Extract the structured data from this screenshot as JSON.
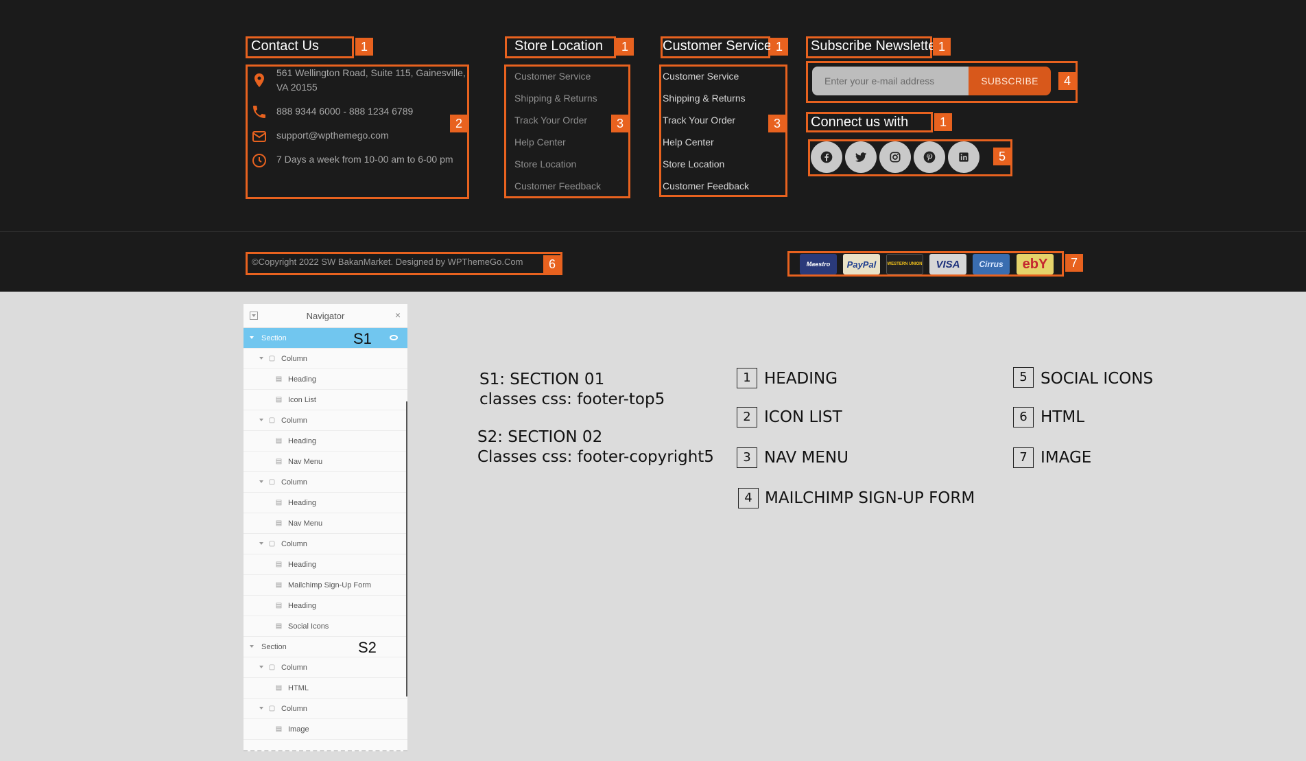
{
  "footer": {
    "contact": {
      "heading": "Contact Us",
      "address": "561 Wellington Road, Suite 115, Gainesville, VA 20155",
      "phone": "888 9344 6000 - 888 1234 6789",
      "email": "support@wpthemego.com",
      "hours": "7 Days a week from 10-00 am to 6-00 pm"
    },
    "store_location": {
      "heading": "Store Location",
      "items": [
        "Customer Service",
        "Shipping & Returns",
        "Track Your Order",
        "Help Center",
        "Store Location",
        "Customer Feedback"
      ]
    },
    "customer_service": {
      "heading": "Customer Service",
      "items": [
        "Customer Service",
        "Shipping & Returns",
        "Track Your Order",
        "Help Center",
        "Store Location",
        "Customer Feedback"
      ]
    },
    "newsletter": {
      "heading": "Subscribe Newsletter",
      "email_placeholder": "Enter your e-mail address",
      "subscribe_label": "SUBSCRIBE"
    },
    "connect": {
      "heading": "Connect us with",
      "icons": [
        "facebook-icon",
        "twitter-icon",
        "instagram-icon",
        "pinterest-icon",
        "linkedin-icon"
      ]
    },
    "copyright": "©Copyright 2022 SW BakanMarket. Designed by WPThemeGo.Com",
    "payments": [
      "Maestro",
      "PayPal",
      "WESTERN UNION",
      "VISA",
      "Cirrus",
      "ebY"
    ]
  },
  "badges": {
    "heading": "1",
    "icon_list": "2",
    "nav_menu": "3",
    "mailchimp": "4",
    "social": "5",
    "html": "6",
    "image": "7"
  },
  "navigator": {
    "title": "Navigator",
    "close": "×",
    "rows": [
      {
        "label": "Section",
        "type": "section",
        "tag": "S1"
      },
      {
        "label": "Column",
        "type": "column"
      },
      {
        "label": "Heading",
        "type": "widget"
      },
      {
        "label": "Icon List",
        "type": "widget"
      },
      {
        "label": "Column",
        "type": "column"
      },
      {
        "label": "Heading",
        "type": "widget"
      },
      {
        "label": "Nav Menu",
        "type": "widget"
      },
      {
        "label": "Column",
        "type": "column"
      },
      {
        "label": "Heading",
        "type": "widget"
      },
      {
        "label": "Nav Menu",
        "type": "widget"
      },
      {
        "label": "Column",
        "type": "column"
      },
      {
        "label": "Heading",
        "type": "widget"
      },
      {
        "label": "Mailchimp Sign-Up Form",
        "type": "widget"
      },
      {
        "label": "Heading",
        "type": "widget"
      },
      {
        "label": "Social Icons",
        "type": "widget"
      },
      {
        "label": "Section",
        "type": "section",
        "tag": "S2"
      },
      {
        "label": "Column",
        "type": "column"
      },
      {
        "label": "HTML",
        "type": "widget"
      },
      {
        "label": "Column",
        "type": "column"
      },
      {
        "label": "Image",
        "type": "widget"
      }
    ]
  },
  "legend": {
    "s1_title": "S1: SECTION 01",
    "s1_class": "classes css: footer-top5",
    "s2_title": "S2: SECTION 02",
    "s2_class": "Classes css: footer-copyright5",
    "items": [
      {
        "num": "1",
        "label": "HEADING"
      },
      {
        "num": "2",
        "label": "ICON LIST"
      },
      {
        "num": "3",
        "label": "NAV MENU"
      },
      {
        "num": "4",
        "label": "MAILCHIMP SIGN-UP FORM"
      },
      {
        "num": "5",
        "label": "SOCIAL ICONS"
      },
      {
        "num": "6",
        "label": "HTML"
      },
      {
        "num": "7",
        "label": "IMAGE"
      }
    ]
  }
}
